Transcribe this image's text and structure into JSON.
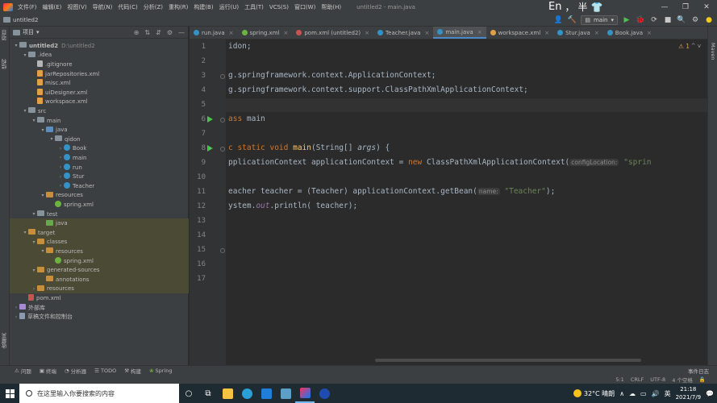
{
  "menu": {
    "items": [
      "文件(F)",
      "编辑(E)",
      "视图(V)",
      "导航(N)",
      "代码(C)",
      "分析(Z)",
      "重构(R)",
      "构建(B)",
      "运行(U)",
      "工具(T)",
      "VCS(S)",
      "窗口(W)",
      "帮助(H)"
    ],
    "window_title": "untitled2 - main.java"
  },
  "ime": {
    "lang": "En",
    "punct": "，",
    "mode": "半",
    "shirt": "👕"
  },
  "window_controls": {
    "minimize": "—",
    "maximize": "❐",
    "close": "✕"
  },
  "navbar": {
    "project": "untitled2"
  },
  "toolbar": {
    "run_config": "main",
    "run_config_icon": "▤",
    "dropdown": "▾",
    "user": "👤",
    "hammer": "🔨",
    "run": "▶",
    "debug": "🐞",
    "coverage": "⟳",
    "stop": "■",
    "search": "🔍",
    "settings": "⚙",
    "update": "●"
  },
  "left_stripe": {
    "project": "项目",
    "structure": "结构",
    "favorites": "收藏夹"
  },
  "right_stripe": {
    "maven": "Maven"
  },
  "project_panel": {
    "title": "项目",
    "tools": [
      "⊕",
      "⇅",
      "⇵",
      "⚙",
      "—"
    ],
    "tree": [
      {
        "label": "untitled2",
        "sub": "D:\\untitled2",
        "depth": 0,
        "arrow": "▾",
        "icon": "folder",
        "bold": true
      },
      {
        "label": ".idea",
        "depth": 1,
        "arrow": "▾",
        "icon": "folder"
      },
      {
        "label": ".gitignore",
        "depth": 2,
        "arrow": "",
        "icon": "file"
      },
      {
        "label": "jarRepositories.xml",
        "depth": 2,
        "arrow": "",
        "icon": "xml"
      },
      {
        "label": "misc.xml",
        "depth": 2,
        "arrow": "",
        "icon": "xml"
      },
      {
        "label": "uiDesigner.xml",
        "depth": 2,
        "arrow": "",
        "icon": "xml"
      },
      {
        "label": "workspace.xml",
        "depth": 2,
        "arrow": "",
        "icon": "xml"
      },
      {
        "label": "src",
        "depth": 1,
        "arrow": "▾",
        "icon": "folder"
      },
      {
        "label": "main",
        "depth": 2,
        "arrow": "▾",
        "icon": "folder"
      },
      {
        "label": "java",
        "depth": 3,
        "arrow": "▾",
        "icon": "folder-blue"
      },
      {
        "label": "qidon",
        "depth": 4,
        "arrow": "▾",
        "icon": "folder"
      },
      {
        "label": "Book",
        "depth": 5,
        "arrow": "›",
        "icon": "class"
      },
      {
        "label": "main",
        "depth": 5,
        "arrow": "›",
        "icon": "class"
      },
      {
        "label": "run",
        "depth": 5,
        "arrow": "›",
        "icon": "class"
      },
      {
        "label": "Stur",
        "depth": 5,
        "arrow": "›",
        "icon": "class"
      },
      {
        "label": "Teacher",
        "depth": 5,
        "arrow": "›",
        "icon": "class"
      },
      {
        "label": "resources",
        "depth": 3,
        "arrow": "▾",
        "icon": "folder-orange"
      },
      {
        "label": "spring.xml",
        "depth": 4,
        "arrow": "",
        "icon": "spring"
      },
      {
        "label": "test",
        "depth": 2,
        "arrow": "▾",
        "icon": "folder"
      },
      {
        "label": "java",
        "depth": 3,
        "arrow": "",
        "icon": "folder-green",
        "hl": true
      },
      {
        "label": "target",
        "depth": 1,
        "arrow": "▾",
        "icon": "folder-orange",
        "hl": true
      },
      {
        "label": "classes",
        "depth": 2,
        "arrow": "▾",
        "icon": "folder-orange",
        "hl": true
      },
      {
        "label": "resources",
        "depth": 3,
        "arrow": "▾",
        "icon": "folder-orange",
        "hl": true
      },
      {
        "label": "spring.xml",
        "depth": 4,
        "arrow": "",
        "icon": "spring",
        "hl": true
      },
      {
        "label": "generated-sources",
        "depth": 2,
        "arrow": "▾",
        "icon": "folder-orange",
        "hl": true
      },
      {
        "label": "annotations",
        "depth": 3,
        "arrow": "",
        "icon": "folder-orange",
        "hl": true
      },
      {
        "label": "resources",
        "depth": 2,
        "arrow": "›",
        "icon": "folder-orange",
        "hl": true
      },
      {
        "label": "pom.xml",
        "depth": 1,
        "arrow": "",
        "icon": "maven"
      },
      {
        "label": "外部库",
        "depth": 0,
        "arrow": "›",
        "icon": "lib"
      },
      {
        "label": "草稿文件和控制台",
        "depth": 0,
        "arrow": "›",
        "icon": "scratch"
      }
    ]
  },
  "tabs": [
    {
      "label": "run.java",
      "icon": "#3592c4",
      "active": false
    },
    {
      "label": "spring.xml",
      "icon": "#6db33f",
      "active": false
    },
    {
      "label": "pom.xml (untitled2)",
      "icon": "#c75450",
      "active": false
    },
    {
      "label": "Teacher.java",
      "icon": "#3592c4",
      "active": false
    },
    {
      "label": "main.java",
      "icon": "#3592c4",
      "active": true
    },
    {
      "label": "workspace.xml",
      "icon": "#e0a146",
      "active": false
    },
    {
      "label": "Stur.java",
      "icon": "#3592c4",
      "active": false
    },
    {
      "label": "Book.java",
      "icon": "#3592c4",
      "active": false
    }
  ],
  "tab_close": "×",
  "editor": {
    "warning": "⚠ 1",
    "warning_nav": "^ v",
    "line_numbers": [
      "1",
      "2",
      "3",
      "4",
      "5",
      "6",
      "7",
      "8",
      "9",
      "10",
      "11",
      "12",
      "13",
      "14",
      "15",
      "16",
      "17"
    ],
    "code": {
      "l1": "idon;",
      "l3a": "g.springframework.context.ApplicationContext;",
      "l4a": "g.springframework.context.support.ClassPathXmlApplicationContext;",
      "l6a": "ass",
      "l6b": " main",
      "l8a": "c ",
      "l8b": "static void ",
      "l8c": "main",
      "l8d": "(String[] ",
      "l8e": "args",
      "l8f": ") {",
      "l9a": "pplicationContext applicationContext = ",
      "l9b": "new ",
      "l9c": "ClassPathXmlApplicationContext(",
      "l9hint": "configLocation:",
      "l9str": " \"sprin",
      "l11a": "eacher teacher = (Teacher) applicationContext.getBean(",
      "l11hint": "name:",
      "l11str": " \"Teacher\"",
      "l11end": ");",
      "l12a": "ystem.",
      "l12b": "out",
      "l12c": ".println( teacher);"
    }
  },
  "bottom_tools": [
    {
      "icon": "⚠",
      "label": "问题"
    },
    {
      "icon": "▣",
      "label": "终端"
    },
    {
      "icon": "◔",
      "label": "分析器"
    },
    {
      "icon": "☰",
      "label": "TODO"
    },
    {
      "icon": "⚒",
      "label": "构建"
    },
    {
      "icon": "❀",
      "label": "Spring"
    }
  ],
  "event_log": "事件日志",
  "status": {
    "pos": "5:1",
    "sep": "CRLF",
    "enc": "UTF-8",
    "indent": "4 个空格",
    "lock": "🔒"
  },
  "taskbar": {
    "search_placeholder": "在这里输入你要搜索的内容",
    "weather": "32°C 晴朗",
    "tray_icons": [
      "∧",
      "☁",
      "▭",
      "🔊",
      "英"
    ],
    "time": "21:18",
    "date": "2021/7/9",
    "notify": "💬"
  }
}
